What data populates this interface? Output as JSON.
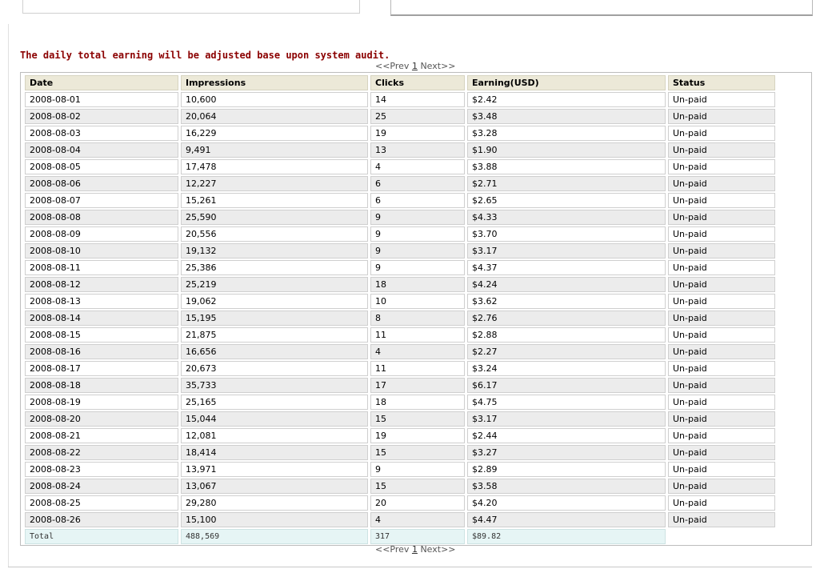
{
  "notice": "The daily total earning will be adjusted base upon system audit.",
  "pager": {
    "prev": "<<Prev",
    "page": "1",
    "next": "Next>>"
  },
  "columns": [
    "Date",
    "Impressions",
    "Clicks",
    "Earning(USD)",
    "Status"
  ],
  "rows": [
    [
      "2008-08-01",
      "10,600",
      "14",
      "$2.42",
      "Un-paid"
    ],
    [
      "2008-08-02",
      "20,064",
      "25",
      "$3.48",
      "Un-paid"
    ],
    [
      "2008-08-03",
      "16,229",
      "19",
      "$3.28",
      "Un-paid"
    ],
    [
      "2008-08-04",
      "9,491",
      "13",
      "$1.90",
      "Un-paid"
    ],
    [
      "2008-08-05",
      "17,478",
      "4",
      "$3.88",
      "Un-paid"
    ],
    [
      "2008-08-06",
      "12,227",
      "6",
      "$2.71",
      "Un-paid"
    ],
    [
      "2008-08-07",
      "15,261",
      "6",
      "$2.65",
      "Un-paid"
    ],
    [
      "2008-08-08",
      "25,590",
      "9",
      "$4.33",
      "Un-paid"
    ],
    [
      "2008-08-09",
      "20,556",
      "9",
      "$3.70",
      "Un-paid"
    ],
    [
      "2008-08-10",
      "19,132",
      "9",
      "$3.17",
      "Un-paid"
    ],
    [
      "2008-08-11",
      "25,386",
      "9",
      "$4.37",
      "Un-paid"
    ],
    [
      "2008-08-12",
      "25,219",
      "18",
      "$4.24",
      "Un-paid"
    ],
    [
      "2008-08-13",
      "19,062",
      "10",
      "$3.62",
      "Un-paid"
    ],
    [
      "2008-08-14",
      "15,195",
      "8",
      "$2.76",
      "Un-paid"
    ],
    [
      "2008-08-15",
      "21,875",
      "11",
      "$2.88",
      "Un-paid"
    ],
    [
      "2008-08-16",
      "16,656",
      "4",
      "$2.27",
      "Un-paid"
    ],
    [
      "2008-08-17",
      "20,673",
      "11",
      "$3.24",
      "Un-paid"
    ],
    [
      "2008-08-18",
      "35,733",
      "17",
      "$6.17",
      "Un-paid"
    ],
    [
      "2008-08-19",
      "25,165",
      "18",
      "$4.75",
      "Un-paid"
    ],
    [
      "2008-08-20",
      "15,044",
      "15",
      "$3.17",
      "Un-paid"
    ],
    [
      "2008-08-21",
      "12,081",
      "19",
      "$2.44",
      "Un-paid"
    ],
    [
      "2008-08-22",
      "18,414",
      "15",
      "$3.27",
      "Un-paid"
    ],
    [
      "2008-08-23",
      "13,971",
      "9",
      "$2.89",
      "Un-paid"
    ],
    [
      "2008-08-24",
      "13,067",
      "15",
      "$3.58",
      "Un-paid"
    ],
    [
      "2008-08-25",
      "29,280",
      "20",
      "$4.20",
      "Un-paid"
    ],
    [
      "2008-08-26",
      "15,100",
      "4",
      "$4.47",
      "Un-paid"
    ]
  ],
  "total": {
    "label": "Total",
    "impressions": "488,569",
    "clicks": "317",
    "earning": "$89.82"
  },
  "colors": {
    "notice": "#8b0000",
    "header_bg": "#ece9d8",
    "row_alt_bg": "#ececec",
    "total_bg": "#e6f5f5"
  }
}
